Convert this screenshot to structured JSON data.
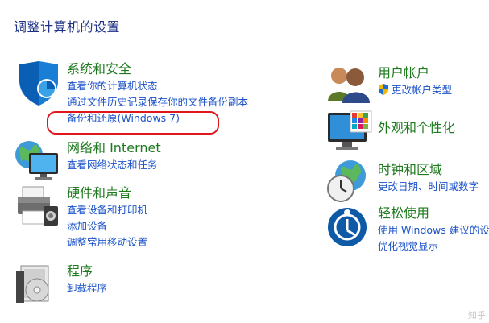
{
  "page_title": "调整计算机的设置",
  "left_categories": [
    {
      "heading": "系统和安全",
      "links": [
        "查看你的计算机状态",
        "通过文件历史记录保存你的文件备份副本",
        "备份和还原(Windows 7)"
      ]
    },
    {
      "heading": "网络和 Internet",
      "links": [
        "查看网络状态和任务"
      ]
    },
    {
      "heading": "硬件和声音",
      "links": [
        "查看设备和打印机",
        "添加设备",
        "调整常用移动设置"
      ]
    },
    {
      "heading": "程序",
      "links": [
        "卸载程序"
      ]
    }
  ],
  "right_categories": [
    {
      "heading": "用户帐户",
      "links": [
        "更改帐户类型"
      ]
    },
    {
      "heading": "外观和个性化",
      "links": []
    },
    {
      "heading": "时钟和区域",
      "links": [
        "更改日期、时间或数字"
      ]
    },
    {
      "heading": "轻松使用",
      "links": [
        "使用 Windows 建议的设",
        "优化视觉显示"
      ]
    }
  ],
  "highlight_color": "#e0161c",
  "watermark": "知乎"
}
